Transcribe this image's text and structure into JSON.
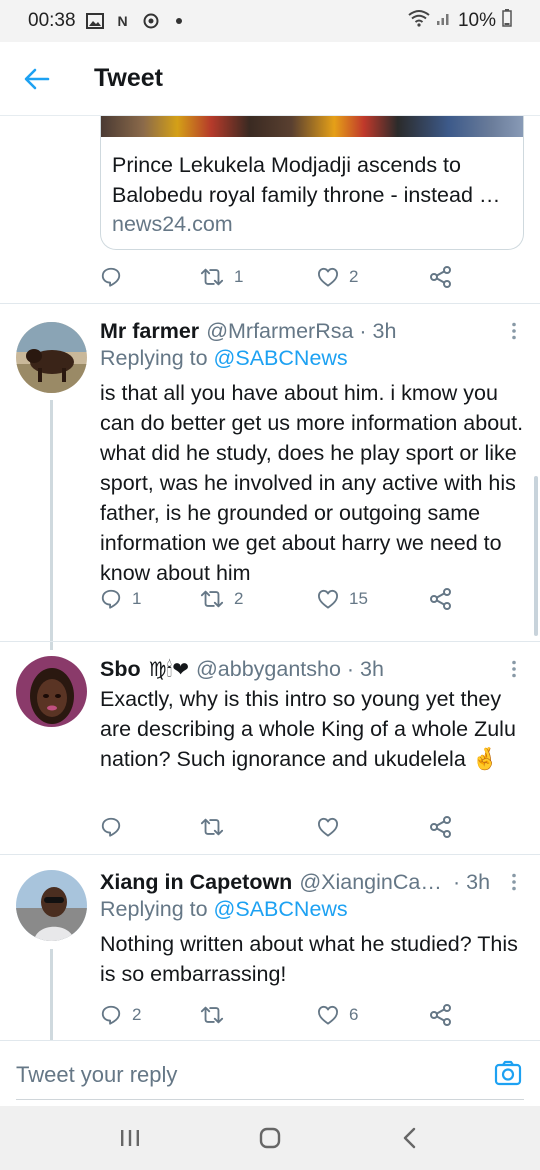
{
  "status_bar": {
    "time": "00:38",
    "battery": "10%",
    "icons": [
      "gallery-icon",
      "n-icon",
      "shield-icon",
      "dot-icon",
      "wifi-icon",
      "signal-icon",
      "battery-icon"
    ]
  },
  "header": {
    "title": "Tweet",
    "back_icon": "arrow-left-icon"
  },
  "link_card": {
    "title": "Prince Lekukela Modjadji ascends to Balobedu royal family throne - instead …",
    "domain": "news24.com"
  },
  "top_actions": {
    "reply_count": "",
    "retweet_count": "1",
    "like_count": "2"
  },
  "tweets": [
    {
      "name": "Mr farmer",
      "handle": "@MrfarmerRsa · 3h",
      "replying_prefix": "Replying to ",
      "replying_to": "@SABCNews",
      "text": "is that all you have about him. i kmow you can do better get us more information about. what did he study, does he play sport or like sport, was he involved  in any active  with his father, is he grounded or outgoing same information  we get about harry we need to know about him",
      "reply_count": "1",
      "retweet_count": "2",
      "like_count": "15"
    },
    {
      "name": "Sbo",
      "name_emoji": "♍🕯❤",
      "handle": "@abbygantsho · 3h",
      "text": "Exactly, why is this intro so young yet they are describing a whole King of a whole Zulu nation? Such ignorance and ukudelela 🤞",
      "reply_count": "",
      "retweet_count": "",
      "like_count": ""
    },
    {
      "name": "Xiang in Capetown",
      "handle": "@XianginCa…",
      "time": "· 3h",
      "replying_prefix": "Replying to ",
      "replying_to": "@SABCNews",
      "text": "Nothing written about what he studied? This is so embarrassing!",
      "reply_count": "2",
      "retweet_count": "",
      "like_count": "6"
    }
  ],
  "composer": {
    "placeholder": "Tweet your reply",
    "camera_icon": "camera-icon"
  },
  "nav_bar": {
    "icons": [
      "recent-apps-icon",
      "home-icon",
      "back-icon"
    ]
  },
  "colors": {
    "accent": "#1da1f2",
    "secondary_text": "#657786",
    "primary_text": "#14171a",
    "divider": "#e1e8ed"
  }
}
